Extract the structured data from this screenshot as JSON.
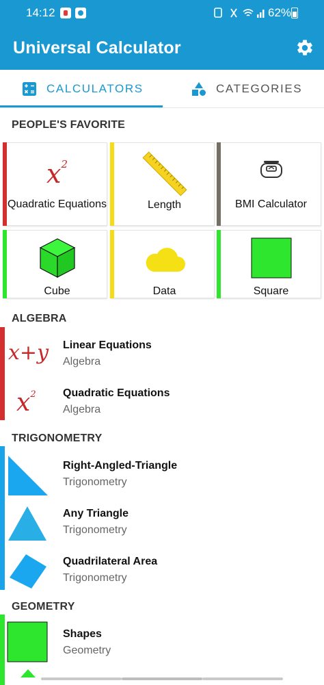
{
  "status_bar": {
    "time": "14:12",
    "battery": "62%"
  },
  "app_bar": {
    "title": "Universal Calculator"
  },
  "tabs": [
    {
      "label": "CALCULATORS",
      "selected": true
    },
    {
      "label": "CATEGORIES",
      "selected": false
    }
  ],
  "favorites": {
    "header": "PEOPLE'S FAVORITE",
    "cards": [
      {
        "label": "Quadratic Equations",
        "icon": "x-squared-icon",
        "accent": "#d32f2f"
      },
      {
        "label": "Length",
        "icon": "ruler-icon",
        "accent": "#f4dd17"
      },
      {
        "label": "BMI Calculator",
        "icon": "scale-icon",
        "accent": "#757066"
      },
      {
        "label": "Cube",
        "icon": "cube-icon",
        "accent": "#2ee62e"
      },
      {
        "label": "Data",
        "icon": "cloud-icon",
        "accent": "#f4dd17"
      },
      {
        "label": "Square",
        "icon": "square-icon",
        "accent": "#2ee62e"
      }
    ]
  },
  "sections": [
    {
      "header": "ALGEBRA",
      "accent": "#d32f2f",
      "items": [
        {
          "title": "Linear Equations",
          "subtitle": "Algebra",
          "icon": "x-plus-y-icon"
        },
        {
          "title": "Quadratic Equations",
          "subtitle": "Algebra",
          "icon": "x-squared-icon"
        }
      ]
    },
    {
      "header": "TRIGONOMETRY",
      "accent": "#1aa3e8",
      "items": [
        {
          "title": "Right-Angled-Triangle",
          "subtitle": "Trigonometry",
          "icon": "right-triangle-icon"
        },
        {
          "title": "Any Triangle",
          "subtitle": "Trigonometry",
          "icon": "triangle-icon"
        },
        {
          "title": "Quadrilateral Area",
          "subtitle": "Trigonometry",
          "icon": "quadrilateral-icon"
        }
      ]
    },
    {
      "header": "GEOMETRY",
      "accent": "#2ee62e",
      "items": [
        {
          "title": "Shapes",
          "subtitle": "Geometry",
          "icon": "square-icon"
        }
      ]
    }
  ],
  "math_glyphs": {
    "x": "x",
    "two": "2",
    "plus": "+",
    "y": "y"
  }
}
